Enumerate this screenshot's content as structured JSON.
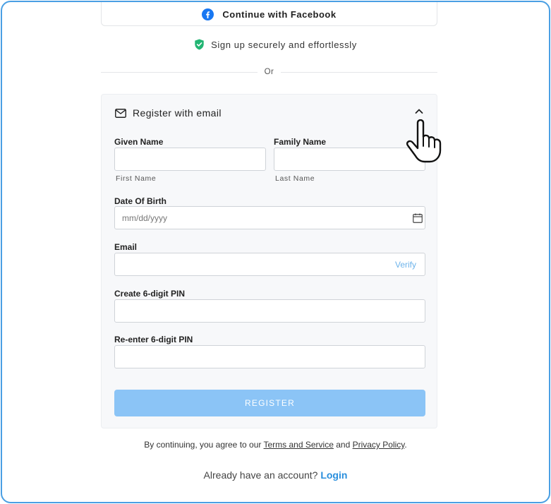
{
  "facebook": {
    "label": "Continue with Facebook",
    "icon": "facebook-icon",
    "brand_color": "#1877f2"
  },
  "secure": {
    "text": "Sign up securely and effortlessly",
    "icon": "shield-check-icon",
    "color": "#22b573"
  },
  "divider": {
    "text": "Or"
  },
  "email_panel": {
    "title": "Register with email",
    "icon": "mail-icon",
    "collapse_icon": "chevron-up-icon",
    "given_name": {
      "label": "Given Name",
      "helper": "First Name",
      "value": ""
    },
    "family_name": {
      "label": "Family Name",
      "helper": "Last Name",
      "value": ""
    },
    "dob": {
      "label": "Date Of Birth",
      "placeholder": "mm/dd/yyyy",
      "icon": "calendar-icon"
    },
    "email": {
      "label": "Email",
      "value": "",
      "verify_label": "Verify"
    },
    "pin": {
      "label": "Create 6-digit PIN",
      "value": ""
    },
    "pin_confirm": {
      "label": "Re-enter 6-digit PIN",
      "value": ""
    },
    "register_label": "REGISTER",
    "register_color": "#8bc4f6"
  },
  "terms": {
    "prefix": "By continuing, you agree to our",
    "terms_link": "Terms and Service",
    "and": "and",
    "privacy_link": "Privacy Policy",
    "suffix": "."
  },
  "login": {
    "prompt": "Already have an account?",
    "link": "Login",
    "link_color": "#2a8fdd"
  },
  "accent_color": "#4a9fe3"
}
